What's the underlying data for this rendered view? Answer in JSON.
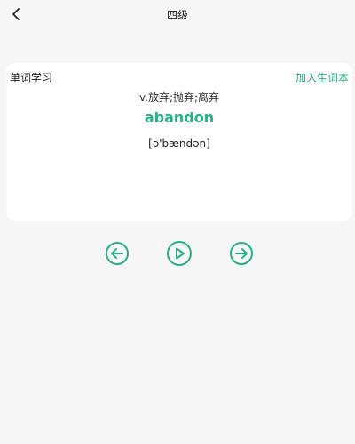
{
  "header": {
    "title": "四级",
    "back_icon": "chevron-left-icon"
  },
  "card": {
    "title": "单词学习",
    "add_vocab_label": "加入生词本",
    "meaning": "v.放弃;抛弃;离弃",
    "word": "abandon",
    "phonetic": "[ə'bændən]"
  },
  "controls": {
    "prev_icon": "arrow-left-circle-icon",
    "play_icon": "play-circle-icon",
    "next_icon": "arrow-right-circle-icon"
  },
  "colors": {
    "accent": "#26b08a",
    "background": "#f6f6f6",
    "card": "#ffffff"
  }
}
